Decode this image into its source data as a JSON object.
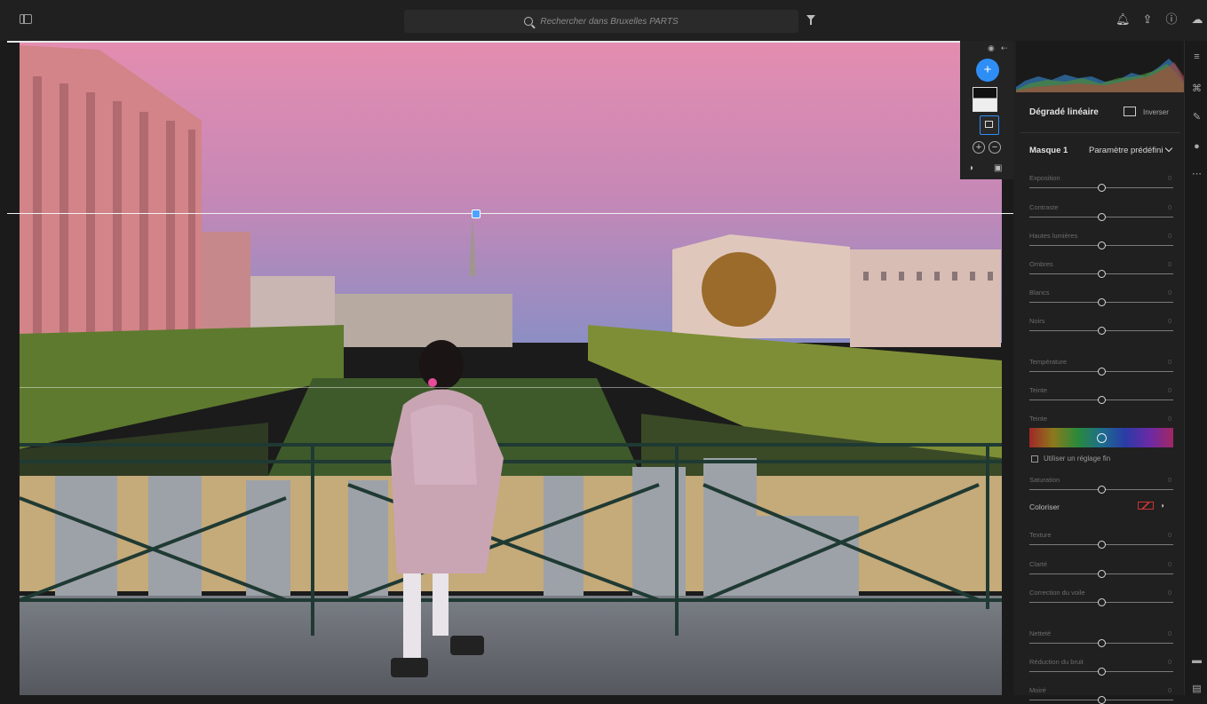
{
  "topbar": {
    "search_placeholder": "Rechercher dans Bruxelles PARTS"
  },
  "mask_panel": {
    "add_label": "+"
  },
  "right_panel": {
    "title": "Dégradé linéaire",
    "invert_label": "Inverser",
    "mask_name": "Masque 1",
    "preset_label": "Paramètre prédéfini",
    "fine_tune_label": "Utiliser un réglage fin",
    "colorize_label": "Coloriser",
    "sliders": [
      {
        "label": "Exposition",
        "value": "0",
        "position": 0.5
      },
      {
        "label": "Contraste",
        "value": "0",
        "position": 0.5
      },
      {
        "label": "Hautes lumières",
        "value": "0",
        "position": 0.5
      },
      {
        "label": "Ombres",
        "value": "0",
        "position": 0.5
      },
      {
        "label": "Blancs",
        "value": "0",
        "position": 0.5
      },
      {
        "label": "Noirs",
        "value": "0",
        "position": 0.5
      },
      {
        "label": "Température",
        "value": "0",
        "position": 0.5
      },
      {
        "label": "Teinte",
        "value": "0",
        "position": 0.5
      },
      {
        "label": "Teinte",
        "value": "0",
        "position": 0.5
      },
      {
        "label": "Saturation",
        "value": "0",
        "position": 0.5
      },
      {
        "label": "Texture",
        "value": "0",
        "position": 0.5
      },
      {
        "label": "Clarté",
        "value": "0",
        "position": 0.5
      },
      {
        "label": "Correction du voile",
        "value": "0",
        "position": 0.5
      },
      {
        "label": "Netteté",
        "value": "0",
        "position": 0.5
      },
      {
        "label": "Réduction du bruit",
        "value": "0",
        "position": 0.5
      },
      {
        "label": "Moiré",
        "value": "0",
        "position": 0.5
      }
    ]
  },
  "colors": {
    "accent": "#2f8ef5",
    "panel_bg": "#202020"
  }
}
